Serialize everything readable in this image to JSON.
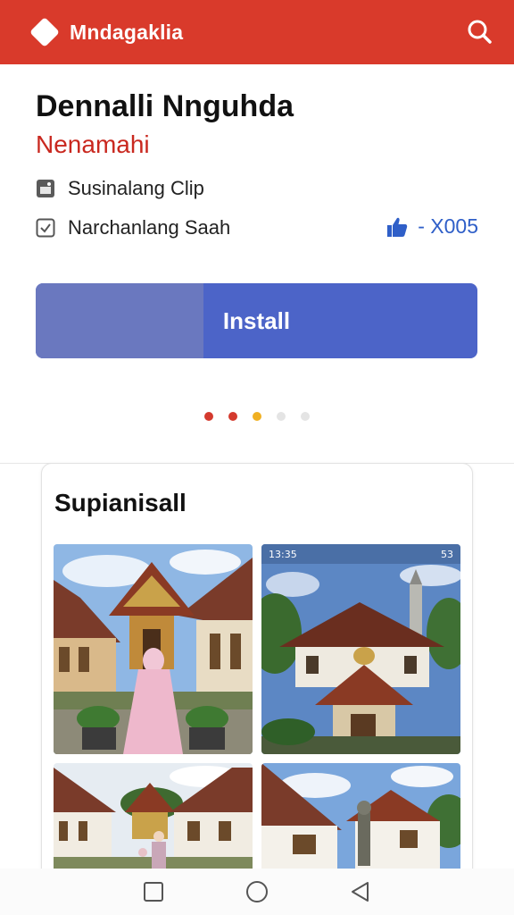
{
  "app_bar": {
    "title": "Mndagaklia",
    "logo_icon": "diamond-logo-icon",
    "search_icon": "search-icon",
    "color": "#d93a2b"
  },
  "app": {
    "title": "Dennalli Nnguhda",
    "subtitle": "Nenamahi",
    "meta": [
      {
        "icon": "image-icon",
        "text": "Susinalang Clip"
      },
      {
        "icon": "checkbox-icon",
        "text": "Narchanlang Saah"
      }
    ],
    "rating": {
      "icon": "thumbs-up-icon",
      "text": "- X005"
    },
    "install_label": "Install",
    "install_progress": 0.38,
    "accent_color": "#4c64c8"
  },
  "carousel": {
    "count": 5,
    "active_index": 0,
    "dot_colors": [
      "#d43a2e",
      "#d43a2e",
      "#f0b022",
      "#e4e4e4",
      "#e4e4e4"
    ]
  },
  "screenshots": {
    "title": "Supianisall",
    "items": [
      {
        "name": "courtyard-gate-photo"
      },
      {
        "name": "pavilion-photo",
        "status_time": "13:35",
        "status_right": "53"
      },
      {
        "name": "long-house-photo"
      },
      {
        "name": "gate-house-photo"
      }
    ]
  },
  "nav": {
    "items": [
      {
        "icon": "square-recents-icon"
      },
      {
        "icon": "circle-home-icon"
      },
      {
        "icon": "triangle-back-icon"
      }
    ]
  }
}
